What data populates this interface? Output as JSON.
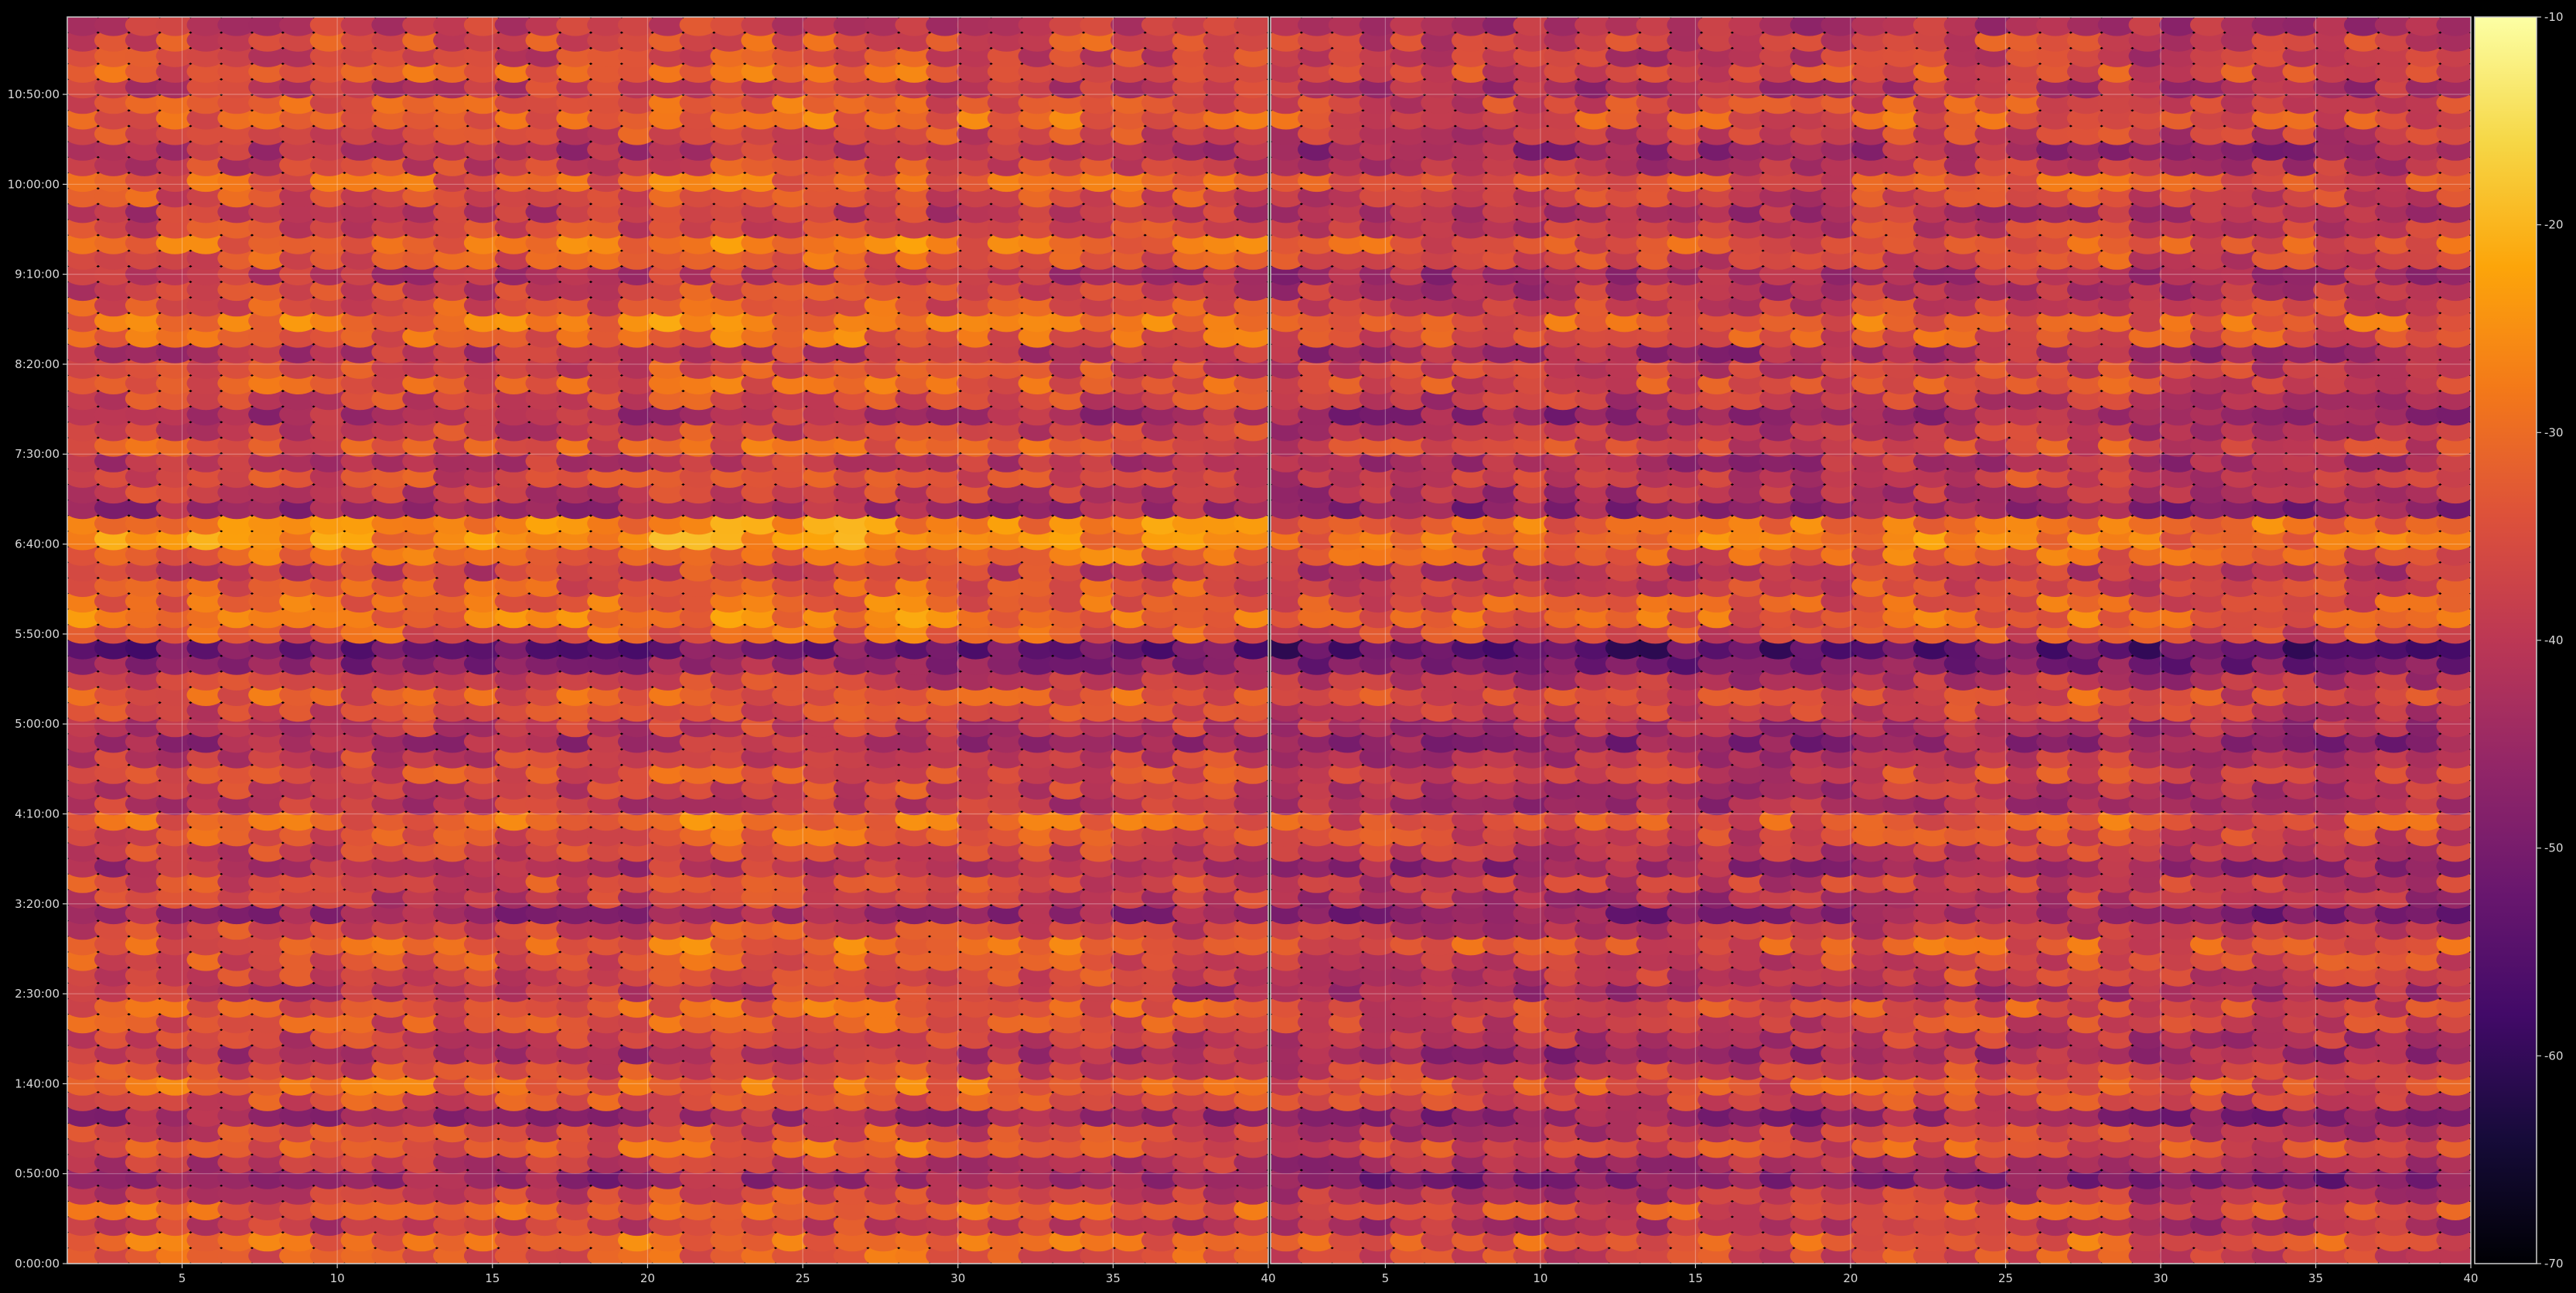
{
  "chart_data": {
    "type": "heatmap",
    "title": "",
    "xlabel": "",
    "ylabel": "",
    "panels": [
      {
        "name": "",
        "xlim": [
          1.3,
          40
        ],
        "xticks": [
          "5",
          "10",
          "15",
          "20",
          "25",
          "30",
          "35",
          "40"
        ]
      },
      {
        "name": "",
        "xlim": [
          1.3,
          40
        ],
        "xticks": [
          "5",
          "10",
          "15",
          "20",
          "25",
          "30",
          "35",
          "40"
        ]
      }
    ],
    "y_ticks": [
      "0:00:00",
      "0:50:00",
      "1:40:00",
      "2:30:00",
      "3:20:00",
      "4:10:00",
      "5:00:00",
      "5:50:00",
      "6:40:00",
      "7:30:00",
      "8:20:00",
      "9:10:00",
      "10:00:00",
      "10:50:00"
    ],
    "y_range_minutes": [
      0,
      693
    ],
    "colorbar": {
      "colormap": "inferno",
      "min": -70,
      "max": -10,
      "ticks": [
        "-10",
        "-20",
        "-30",
        "-40",
        "-50",
        "-60",
        "-70"
      ]
    },
    "grid": true,
    "columns": 39,
    "rows": 80,
    "band_profile_db": [
      -34,
      -30,
      -39,
      -32,
      -38,
      -46,
      -40,
      -33,
      -37,
      -44,
      -35,
      -31,
      -36,
      -42,
      -38,
      -35,
      -33,
      -40,
      -36,
      -34,
      -31,
      -37,
      -45,
      -39,
      -36,
      -42,
      -37,
      -34,
      -31,
      -40,
      -38,
      -35,
      -38,
      -44,
      -40,
      -36,
      -33,
      -39,
      -47,
      -52,
      -33,
      -29,
      -31,
      -34,
      -38,
      -30,
      -26,
      -27,
      -44,
      -39,
      -36,
      -40,
      -34,
      -38,
      -43,
      -37,
      -33,
      -36,
      -41,
      -32,
      -29,
      -35,
      -38,
      -41,
      -34,
      -30,
      -37,
      -40,
      -35,
      -32,
      -38,
      -42,
      -36,
      -31,
      -34,
      -39,
      -33,
      -37,
      -35,
      -40
    ]
  }
}
